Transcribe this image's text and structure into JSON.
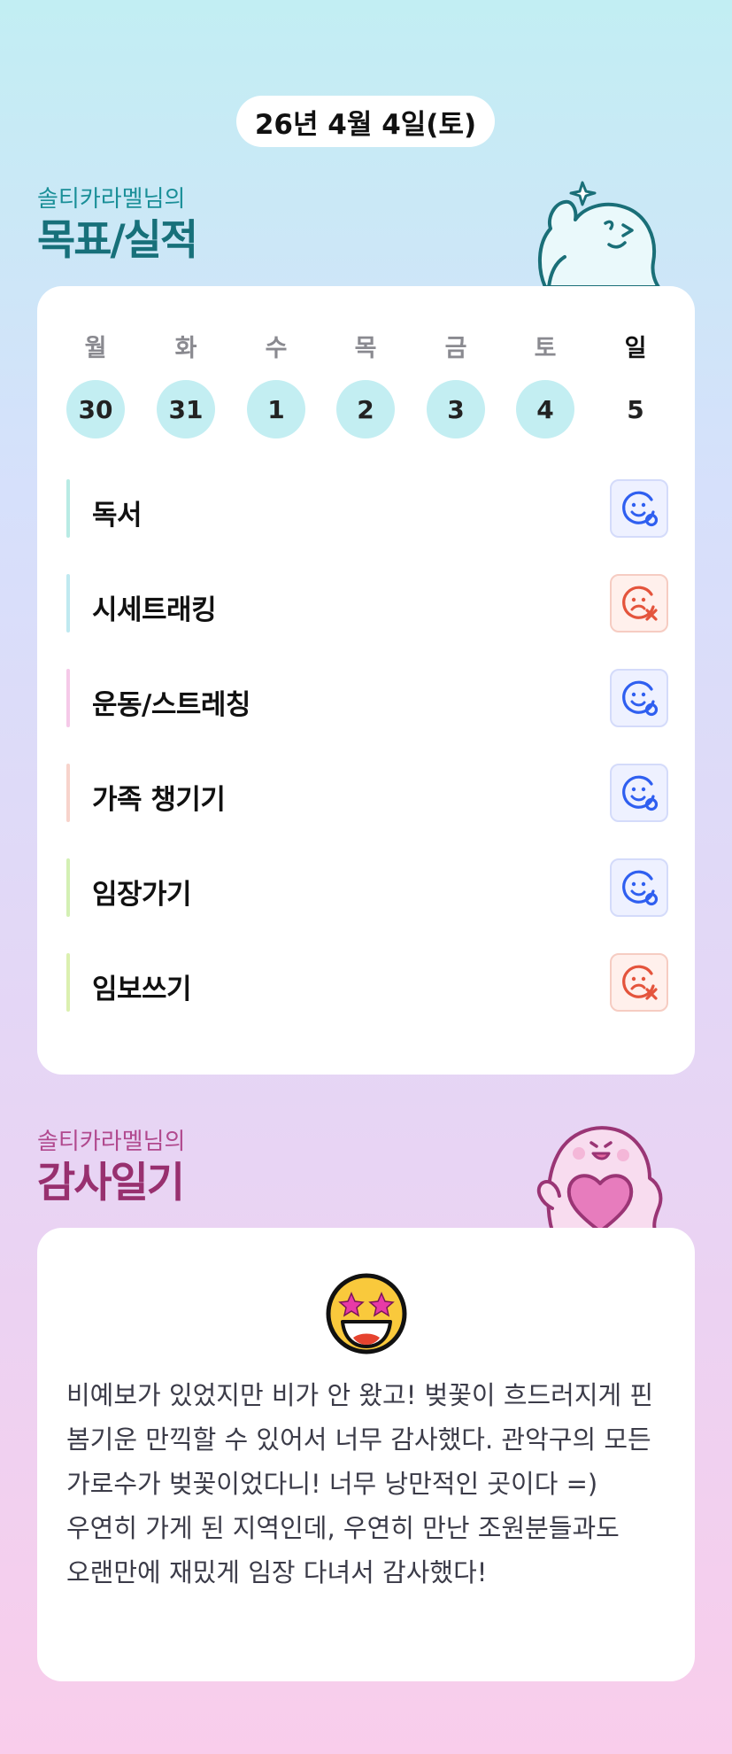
{
  "header": {
    "date": "26년 4월 4일(토)"
  },
  "goals_section": {
    "owner_label": "솔티카라멜님의",
    "title": "목표/실적",
    "accent_color": "#17707a"
  },
  "week": [
    {
      "label": "월",
      "day": "30",
      "checked": true
    },
    {
      "label": "화",
      "day": "31",
      "checked": true
    },
    {
      "label": "수",
      "day": "1",
      "checked": true
    },
    {
      "label": "목",
      "day": "2",
      "checked": true
    },
    {
      "label": "금",
      "day": "3",
      "checked": true
    },
    {
      "label": "토",
      "day": "4",
      "checked": true
    },
    {
      "label": "일",
      "day": "5",
      "checked": false
    }
  ],
  "goals": [
    {
      "name": "독서",
      "status": "done",
      "color": "#b8ebe4"
    },
    {
      "name": "시세트래킹",
      "status": "missed",
      "color": "#bfe9f0"
    },
    {
      "name": "운동/스트레칭",
      "status": "done",
      "color": "#f5c9e8"
    },
    {
      "name": "가족 챙기기",
      "status": "done",
      "color": "#f7d3cb"
    },
    {
      "name": "임장가기",
      "status": "done",
      "color": "#d3f0b4"
    },
    {
      "name": "임보쓰기",
      "status": "missed",
      "color": "#dbf0b0"
    }
  ],
  "thanks_section": {
    "owner_label": "솔티카라멜님의",
    "title": "감사일기",
    "accent_color": "#98306f",
    "mood_icon": "star-struck-emoji",
    "text": "비예보가 있었지만 비가 안 왔고! 벚꽃이 흐드러지게 핀 봄기운 만끽할 수 있어서 너무 감사했다. 관악구의 모든 가로수가 벚꽃이었다니! 너무 낭만적인 곳이다 =) 우연히 가게 된 지역인데, 우연히 만난 조원분들과도 오랜만에 재밌게 임장 다녀서 감사했다!"
  },
  "colors": {
    "done_icon": "#2f5ff0",
    "missed_icon": "#e4543c",
    "checked_day": "#c3eef2"
  }
}
